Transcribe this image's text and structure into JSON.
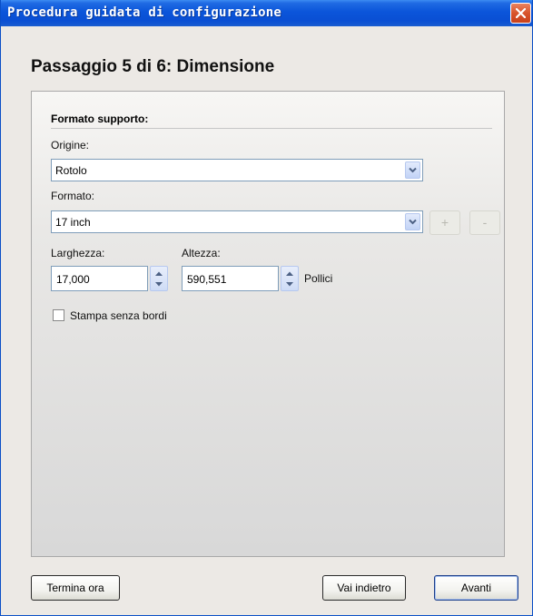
{
  "window": {
    "title": "Procedura guidata di configurazione"
  },
  "step_title": "Passaggio 5 di 6: Dimensione",
  "section": {
    "title": "Formato supporto:"
  },
  "origin": {
    "label": "Origine:",
    "value": "Rotolo"
  },
  "format": {
    "label": "Formato:",
    "value": "17 inch",
    "add_label": "+",
    "remove_label": "-"
  },
  "width": {
    "label": "Larghezza:",
    "value": "17,000"
  },
  "height": {
    "label": "Altezza:",
    "value": "590,551",
    "unit": "Pollici"
  },
  "borderless": {
    "label": "Stampa senza bordi",
    "checked": false
  },
  "buttons": {
    "finish": "Termina ora",
    "back": "Vai indietro",
    "next": "Avanti"
  },
  "icons": {
    "close": "close-icon",
    "dropdown": "chevron-down-icon",
    "spin_up": "arrow-up-icon",
    "spin_down": "arrow-down-icon"
  },
  "colors": {
    "titlebar": "#0b55da",
    "close_button": "#d8542c",
    "input_border": "#7f9db9"
  }
}
